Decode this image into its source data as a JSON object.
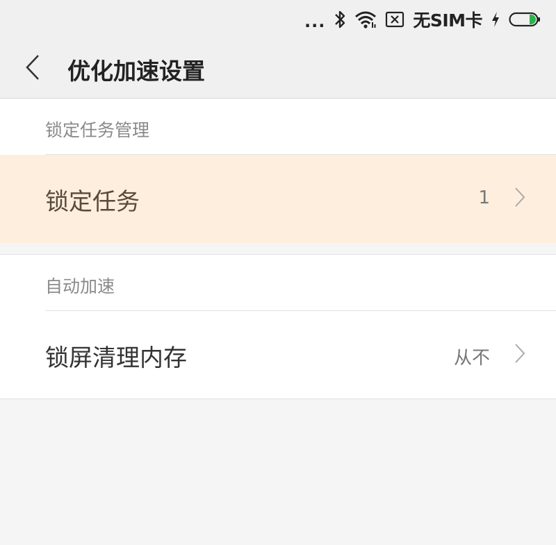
{
  "status_bar": {
    "dots": "...",
    "carrier": "无SIM卡",
    "icons": [
      "bluetooth-icon",
      "wifi-icon",
      "sim-icon",
      "charging-icon",
      "battery-icon"
    ],
    "battery_color": "#2bb24c"
  },
  "header": {
    "back_icon": "chevron-left-icon",
    "title": "优化加速设置"
  },
  "sections": [
    {
      "header": "锁定任务管理",
      "rows": [
        {
          "label": "锁定任务",
          "value": "1",
          "highlighted": true
        }
      ]
    },
    {
      "header": "自动加速",
      "rows": [
        {
          "label": "锁屏清理内存",
          "value": "从不",
          "highlighted": false
        }
      ]
    }
  ],
  "colors": {
    "highlight_bg": "#fdeedd",
    "page_bg": "#f5f5f5",
    "bar_bg": "#f0f0f0"
  }
}
